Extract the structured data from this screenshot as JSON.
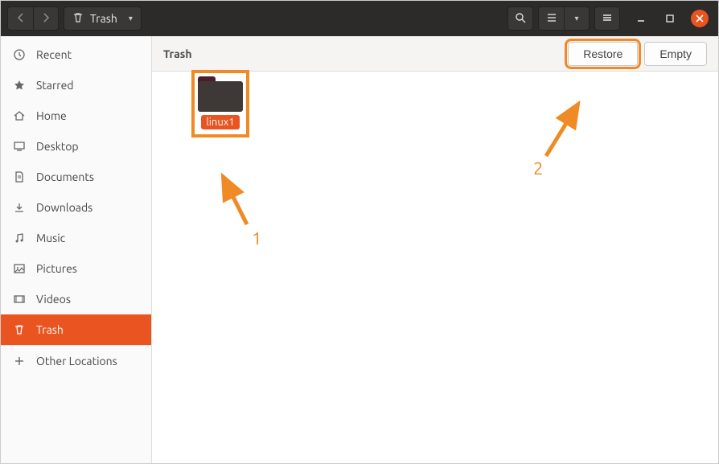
{
  "titlebar": {
    "location_label": "Trash"
  },
  "sidebar": {
    "items": [
      {
        "label": "Recent",
        "icon": "clock"
      },
      {
        "label": "Starred",
        "icon": "star"
      },
      {
        "label": "Home",
        "icon": "home"
      },
      {
        "label": "Desktop",
        "icon": "desktop"
      },
      {
        "label": "Documents",
        "icon": "document"
      },
      {
        "label": "Downloads",
        "icon": "download"
      },
      {
        "label": "Music",
        "icon": "music"
      },
      {
        "label": "Pictures",
        "icon": "picture"
      },
      {
        "label": "Videos",
        "icon": "video"
      },
      {
        "label": "Trash",
        "icon": "trash",
        "active": true
      },
      {
        "label": "Other Locations",
        "icon": "plus"
      }
    ]
  },
  "content": {
    "title": "Trash",
    "restore_label": "Restore",
    "empty_label": "Empty",
    "files": [
      {
        "name": "linux1",
        "type": "folder",
        "selected": true
      }
    ]
  },
  "annotations": {
    "num1": "1",
    "num2": "2"
  },
  "colors": {
    "accent": "#e95420",
    "highlight": "#f08a24"
  }
}
